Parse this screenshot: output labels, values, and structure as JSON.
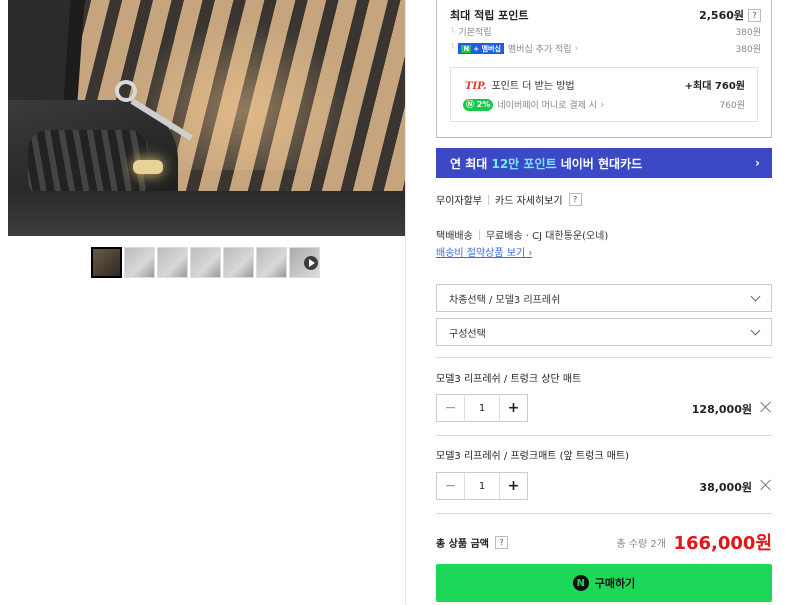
{
  "points": {
    "title": "최대 적립 포인트",
    "amount": "2,560원",
    "help": "?",
    "basic_label": "기본적립",
    "basic_amount": "380원",
    "membership_badge_n": "N",
    "membership_badge_text": "+ 멤버십",
    "membership_label": "멤버십 추가 적립",
    "membership_amount": "380원"
  },
  "tip": {
    "label": "TIP.",
    "title": "포인트 더 받는 방법",
    "max": "+최대 760원",
    "pay_badge": "2%",
    "link": "네이버페이 머니로 결제 시",
    "link_amount": "760원"
  },
  "card_banner": {
    "prefix": "연 최대 ",
    "highlight": "12만 포인트",
    "suffix": " 네이버 현대카드",
    "arrow": "›"
  },
  "installment": {
    "label": "무이자할부",
    "card_detail": "카드 자세히보기",
    "help": "?"
  },
  "shipping": {
    "type": "택배배송",
    "info": "무료배송 · CJ 대한통운(오네)",
    "link": "배송비 절약상품 보기 ›"
  },
  "selects": [
    {
      "value": "차종선택 / 모델3 리프레쉬"
    },
    {
      "value": "구성선택"
    }
  ],
  "options": [
    {
      "name": "모델3 리프레쉬 / 트렁크 상단 매트",
      "qty": "1",
      "price": "128,000원",
      "minus": "−",
      "plus": "+"
    },
    {
      "name": "모델3 리프레쉬 / 프렁크매트 (앞 트렁크 매트)",
      "qty": "1",
      "price": "38,000원",
      "minus": "−",
      "plus": "+"
    }
  ],
  "total": {
    "label": "총 상품 금액",
    "help": "?",
    "count": "총 수량 2개",
    "price": "166,000원"
  },
  "buy": {
    "logo": "N",
    "label": "구매하기"
  },
  "colors": {
    "banner": "#3c49c6",
    "buy_button": "#1ed758",
    "total_price": "#e1151a"
  }
}
